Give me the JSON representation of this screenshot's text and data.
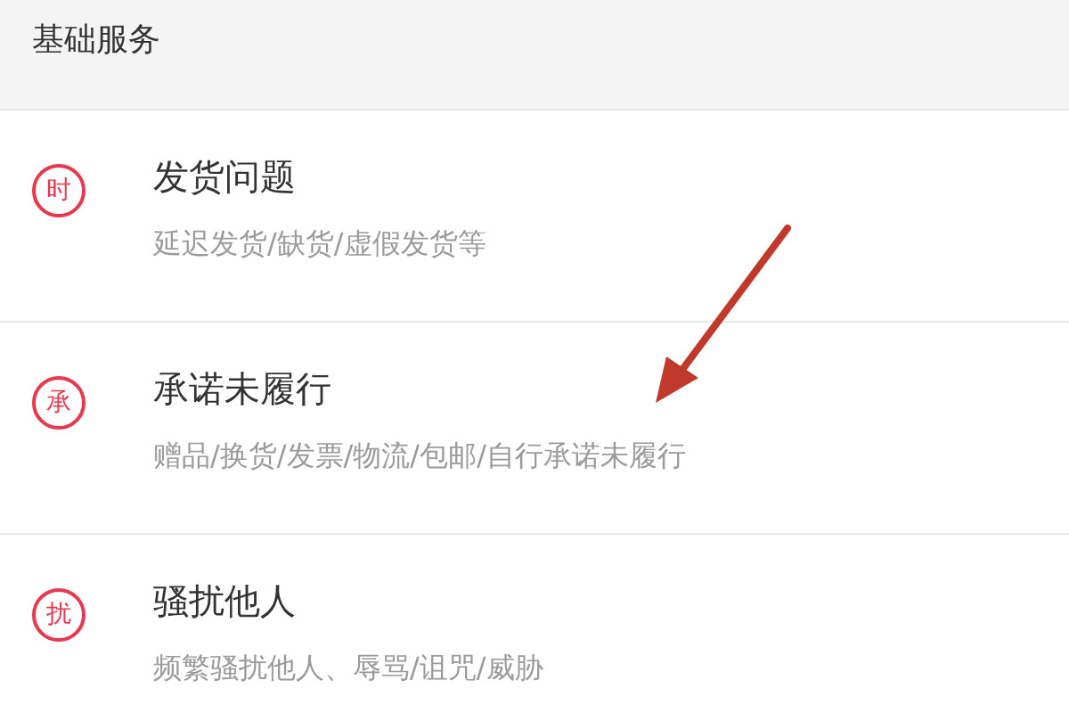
{
  "section": {
    "title": "基础服务"
  },
  "items": [
    {
      "icon": "时",
      "title": "发货问题",
      "subtitle": "延迟发货/缺货/虚假发货等"
    },
    {
      "icon": "承",
      "title": "承诺未履行",
      "subtitle": "赠品/换货/发票/物流/包邮/自行承诺未履行"
    },
    {
      "icon": "扰",
      "title": "骚扰他人",
      "subtitle": "频繁骚扰他人、辱骂/诅咒/威胁"
    }
  ]
}
